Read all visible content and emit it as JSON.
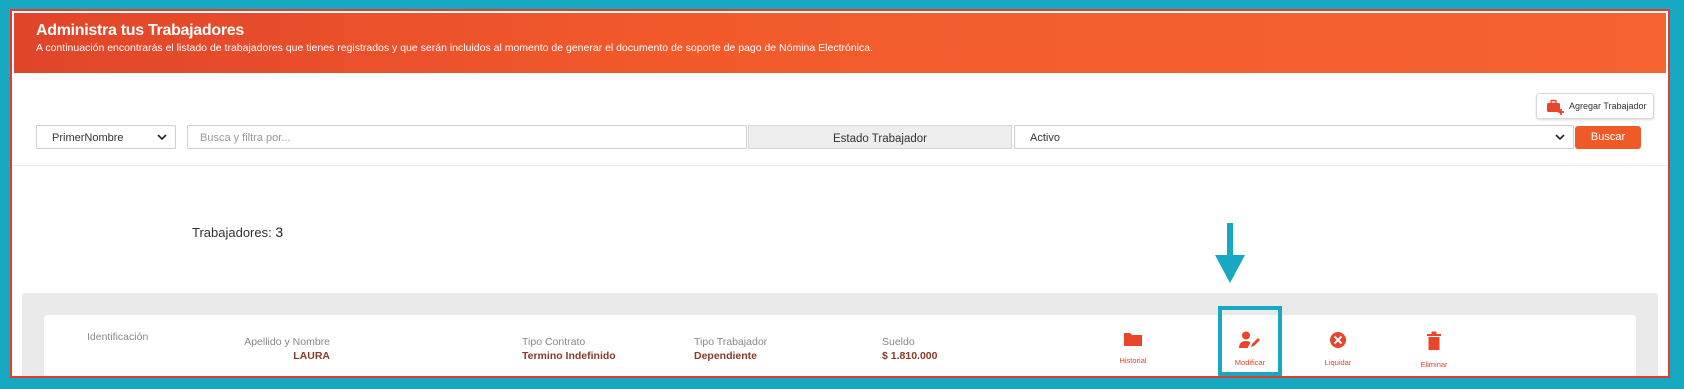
{
  "header": {
    "title": "Administra tus Trabajadores",
    "subtitle": "A continuación encontrarás el listado de trabajadores que tienes registrados y que serán incluidos al momento de generar el documento de soporte de pago de Nómina Electrónica."
  },
  "toolbar": {
    "add_worker_label": "Agregar Trabajador"
  },
  "filters": {
    "field_select_value": "PrimerNombre",
    "search_placeholder": "Busca y filtra por...",
    "estado_label": "Estado Trabajador",
    "estado_select_value": "Activo",
    "search_button": "Buscar"
  },
  "summary": {
    "label": "Trabajadores:",
    "count": "3"
  },
  "worker": {
    "identificacion_label": "Identificación",
    "nombre_label": "Apellido y Nombre",
    "nombre_value": "LAURA",
    "tipo_contrato_label": "Tipo Contrato",
    "tipo_contrato_value": "Termino Indefinido",
    "tipo_trabajador_label": "Tipo Trabajador",
    "tipo_trabajador_value": "Dependiente",
    "sueldo_label": "Sueldo",
    "sueldo_value": "$ 1.810.000"
  },
  "actions": {
    "historial": "Historial",
    "modificar": "Modificar",
    "liquidar": "Liquidar",
    "eliminar": "Eliminar"
  },
  "colors": {
    "accent": "#f05a29",
    "frame": "#17a9c1",
    "value_text": "#8a3a2a"
  }
}
